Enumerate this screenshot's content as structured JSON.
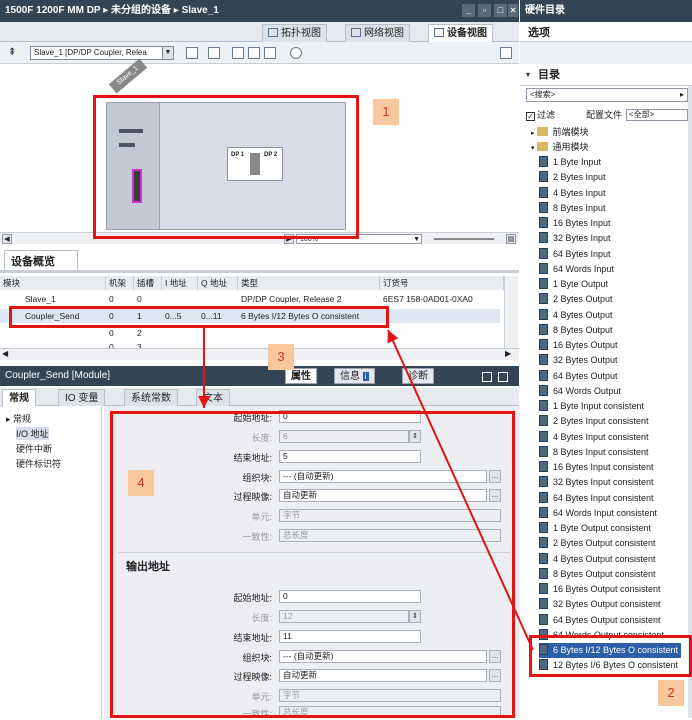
{
  "window": {
    "breadcrumb": [
      "1500F 1200F MM DP",
      "未分组的设备",
      "Slave_1"
    ],
    "view_tabs": [
      "拓扑视图",
      "网络视图",
      "设备视图"
    ],
    "device_select": "Slave_1 [DP/DP Coupler, Relea",
    "zoom": "100%"
  },
  "canvas": {
    "rack_label": "Slave_1",
    "module_ports": [
      "DP 1",
      "DP 2"
    ]
  },
  "callouts": [
    "1",
    "2",
    "3",
    "4"
  ],
  "overview": {
    "title": "设备概览",
    "columns": [
      "模块",
      "机架",
      "插槽",
      "I 地址",
      "Q 地址",
      "类型",
      "订货号"
    ],
    "rows": [
      [
        "Slave_1",
        "0",
        "0",
        "",
        "",
        "DP/DP Coupler, Release 2",
        "6ES7 158-0AD01-0XA0"
      ],
      [
        "Coupler_Send",
        "0",
        "1",
        "0...5",
        "0...11",
        "6 Bytes I/12 Bytes O consistent",
        ""
      ],
      [
        "",
        "0",
        "2",
        "",
        "",
        "",
        ""
      ],
      [
        "",
        "0",
        "3",
        "",
        "",
        "",
        ""
      ]
    ]
  },
  "properties": {
    "title": "Coupler_Send [Module]",
    "tabs": [
      "属性",
      "信息",
      "诊断"
    ],
    "subtabs": [
      "常规",
      "IO 变量",
      "系统常数",
      "文本"
    ],
    "nav": [
      "常规",
      "I/O 地址",
      "硬件中断",
      "硬件标识符"
    ],
    "input": {
      "start_label": "起始地址:",
      "start": "0",
      "length_label": "长度:",
      "length": "6",
      "end_label": "结束地址:",
      "end": "5",
      "ob_label": "组织块:",
      "ob": "--- (自动更新)",
      "pi_label": "过程映像:",
      "pi": "自动更新",
      "unit_label": "单元:",
      "unit": "字节",
      "cons_label": "一致性:",
      "cons": "总长度"
    },
    "output": {
      "section": "输出地址",
      "start_label": "起始地址:",
      "start": "0",
      "length_label": "长度:",
      "length": "12",
      "end_label": "结束地址:",
      "end": "11",
      "ob_label": "组织块:",
      "ob": "--- (自动更新)",
      "pi_label": "过程映像:",
      "pi": "自动更新",
      "unit_label": "单元:",
      "unit": "字节",
      "cons_label": "一致性:",
      "cons": "总长度"
    }
  },
  "catalog": {
    "title": "硬件目录",
    "options": "选项",
    "section": "目录",
    "search_placeholder": "<搜索>",
    "filter_label": "过滤",
    "profile_label": "配置文件",
    "profile_value": "<全部>",
    "folders": [
      "前端模块",
      "通用模块"
    ],
    "items": [
      "1 Byte Input",
      "2 Bytes Input",
      "4 Bytes Input",
      "8 Bytes Input",
      "16 Bytes Input",
      "32 Bytes Input",
      "64 Bytes Input",
      "64 Words Input",
      "1 Byte Output",
      "2 Bytes Output",
      "4 Bytes Output",
      "8 Bytes Output",
      "16 Bytes Output",
      "32 Bytes Output",
      "64 Bytes Output",
      "64 Words Output",
      "1 Byte Input consistent",
      "2 Bytes Input consistent",
      "4 Bytes Input consistent",
      "8 Bytes Input consistent",
      "16 Bytes Input consistent",
      "32 Bytes Input consistent",
      "64 Bytes Input consistent",
      "64 Words Input consistent",
      "1 Byte Output consistent",
      "2 Bytes Output consistent",
      "4 Bytes Output consistent",
      "8 Bytes Output consistent",
      "16 Bytes Output consistent",
      "32 Bytes Output consistent",
      "64 Bytes Output consistent",
      "64 Words Output consistent",
      "6 Bytes I/12 Bytes O consistent",
      "12 Bytes I/6 Bytes O consistent"
    ],
    "selected_index": 32
  },
  "colors": {
    "title_bar": "#334455",
    "highlight": "#e21414",
    "callout_bg": "#f8c79e",
    "selection": "#2d5ea8"
  }
}
